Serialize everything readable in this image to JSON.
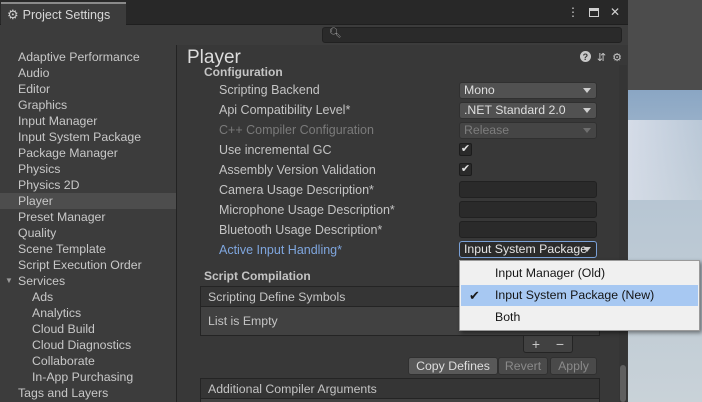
{
  "window": {
    "tab_title": "Project Settings",
    "tab_icon": "gear-icon",
    "menu_icon": "kebab-menu-icon",
    "maximize_icon": "maximize-icon",
    "close_icon": "close-icon"
  },
  "search": {
    "placeholder": "",
    "icon": "search-icon"
  },
  "sidebar": {
    "items": [
      {
        "label": "Adaptive Performance"
      },
      {
        "label": "Audio"
      },
      {
        "label": "Editor"
      },
      {
        "label": "Graphics"
      },
      {
        "label": "Input Manager"
      },
      {
        "label": "Input System Package"
      },
      {
        "label": "Package Manager"
      },
      {
        "label": "Physics"
      },
      {
        "label": "Physics 2D"
      },
      {
        "label": "Player",
        "selected": true
      },
      {
        "label": "Preset Manager"
      },
      {
        "label": "Quality"
      },
      {
        "label": "Scene Template"
      },
      {
        "label": "Script Execution Order"
      },
      {
        "label": "Services",
        "expanded": true
      },
      {
        "label": "Ads"
      },
      {
        "label": "Analytics"
      },
      {
        "label": "Cloud Build"
      },
      {
        "label": "Cloud Diagnostics"
      },
      {
        "label": "Collaborate"
      },
      {
        "label": "In-App Purchasing"
      },
      {
        "label": "Tags and Layers"
      }
    ]
  },
  "main": {
    "title": "Player",
    "header_icons": [
      "help-icon",
      "preset-sliders-icon",
      "settings-gear-icon"
    ],
    "configuration": {
      "heading": "Configuration",
      "scripting_backend": {
        "label": "Scripting Backend",
        "value": "Mono"
      },
      "api_compat": {
        "label": "Api Compatibility Level*",
        "value": ".NET Standard 2.0"
      },
      "cpp_compiler": {
        "label": "C++ Compiler Configuration",
        "value": "Release",
        "enabled": false
      },
      "incremental_gc": {
        "label": "Use incremental GC",
        "checked": true
      },
      "assembly_validation": {
        "label": "Assembly Version Validation",
        "checked": true
      },
      "camera_usage": {
        "label": "Camera Usage Description*",
        "value": ""
      },
      "microphone_usage": {
        "label": "Microphone Usage Description*",
        "value": ""
      },
      "bluetooth_usage": {
        "label": "Bluetooth Usage Description*",
        "value": ""
      },
      "active_input": {
        "label": "Active Input Handling*",
        "value": "Input System Package"
      }
    },
    "script_compilation": {
      "heading": "Script Compilation",
      "define_symbols": {
        "header": "Scripting Define Symbols",
        "empty_text": "List is Empty"
      },
      "add_label": "+",
      "remove_label": "−",
      "copy_defines": "Copy Defines",
      "revert": "Revert",
      "apply": "Apply",
      "compiler_args": {
        "header": "Additional Compiler Arguments"
      }
    }
  },
  "popup": {
    "options": [
      {
        "label": "Input Manager (Old)",
        "selected": false
      },
      {
        "label": "Input System Package (New)",
        "selected": true
      },
      {
        "label": "Both",
        "selected": false
      }
    ],
    "check_glyph": "✔"
  }
}
